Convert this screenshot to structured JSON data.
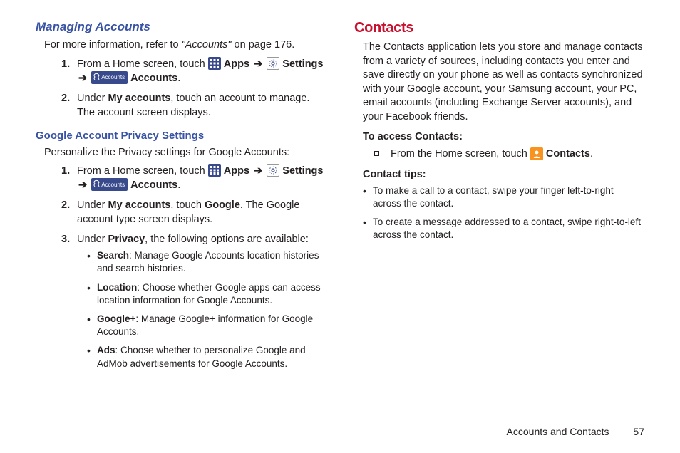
{
  "left": {
    "heading": "Managing Accounts",
    "intro_prefix": "For more information, refer to ",
    "intro_ref": "\"Accounts\"",
    "intro_suffix": " on page 176.",
    "steps": [
      {
        "num": "1.",
        "prefix": "From a Home screen, touch ",
        "apps_label": "Apps",
        "settings_label": "Settings",
        "accounts_label": "Accounts",
        "suffix": "."
      },
      {
        "num": "2.",
        "prefix": "Under ",
        "bold1": "My accounts",
        "mid": ", touch an account to manage. The account screen displays."
      }
    ],
    "sub_heading": "Google Account Privacy Settings",
    "sub_intro": "Personalize the Privacy settings for Google Accounts:",
    "sub_steps": [
      {
        "num": "1.",
        "prefix": "From a Home screen, touch ",
        "apps_label": "Apps",
        "settings_label": "Settings",
        "accounts_label": "Accounts",
        "suffix": "."
      },
      {
        "num": "2.",
        "prefix": "Under ",
        "bold1": "My accounts",
        "mid": ", touch ",
        "bold2": "Google",
        "suffix": ". The Google account type screen displays."
      },
      {
        "num": "3.",
        "prefix": "Under ",
        "bold1": "Privacy",
        "mid": ", the following options are available:"
      }
    ],
    "privacy_opts": [
      {
        "name": "Search",
        "desc": ": Manage Google Accounts location histories and search histories."
      },
      {
        "name": "Location",
        "desc": ": Choose whether Google apps can access location information for Google Accounts."
      },
      {
        "name": "Google+",
        "desc": ": Manage Google+ information for Google Accounts."
      },
      {
        "name": "Ads",
        "desc": ": Choose whether to personalize Google and AdMob advertisements for Google Accounts."
      }
    ]
  },
  "right": {
    "heading": "Contacts",
    "intro": "The Contacts application lets you store and manage contacts from a variety of sources, including contacts you enter and save directly on your phone as well as contacts synchronized with your Google account, your Samsung account, your PC, email accounts (including Exchange Server accounts), and your Facebook friends.",
    "access_heading": "To access Contacts:",
    "access_prefix": "From the Home screen, touch ",
    "access_label": "Contacts",
    "access_suffix": ".",
    "tips_heading": "Contact tips:",
    "tips": [
      "To make a call to a contact, swipe your finger left-to-right across the contact.",
      "To create a message addressed to a contact, swipe right-to-left across the contact."
    ]
  },
  "footer": {
    "section": "Accounts and Contacts",
    "page": "57"
  },
  "icons": {
    "accounts_text": "Accounts"
  }
}
